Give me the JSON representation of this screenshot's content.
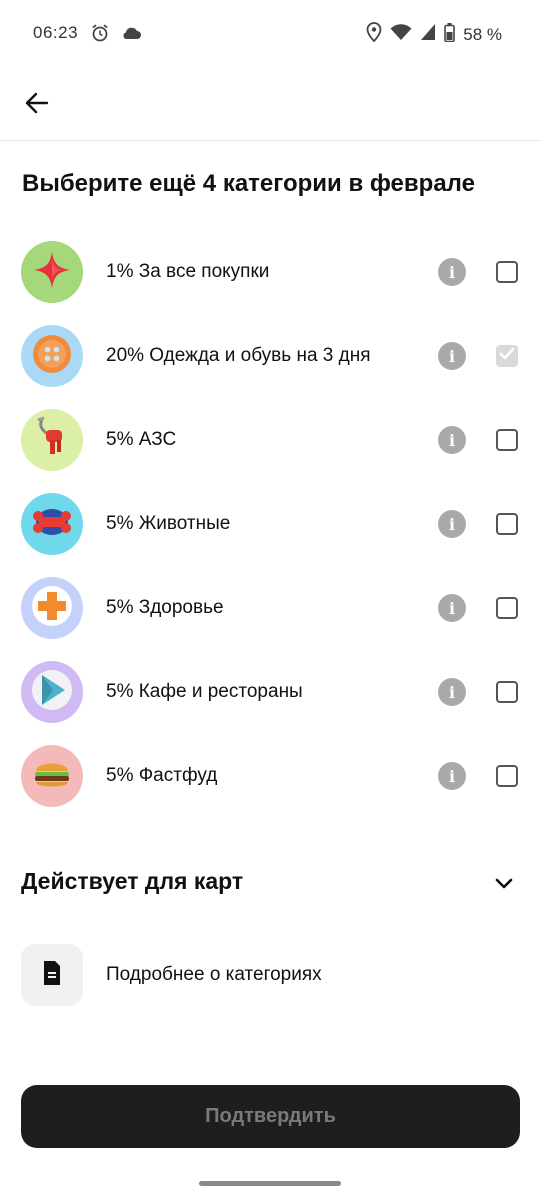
{
  "status_bar": {
    "time": "06:23",
    "battery": "58 %",
    "left_icons": [
      "alarm-icon",
      "cloud-icon"
    ],
    "right_icons": [
      "location-icon",
      "wifi-icon",
      "signal-icon",
      "battery-icon"
    ]
  },
  "header": {
    "back_icon": "arrow-left-icon",
    "title": "Выберите ещё 4 категории в феврале"
  },
  "categories": [
    {
      "label": "1% За все покупки",
      "icon": "star-icon",
      "bg": "#a4d87a",
      "checked": false
    },
    {
      "label": "20% Одежда и обувь на 3 дня",
      "icon": "button-icon",
      "bg": "#a9d9f5",
      "checked": true
    },
    {
      "label": "5% АЗС",
      "icon": "fuel-nozzle-icon",
      "bg": "#dcefa6",
      "checked": false
    },
    {
      "label": "5% Животные",
      "icon": "bone-icon",
      "bg": "#6fd8ea",
      "checked": false
    },
    {
      "label": "5% Здоровье",
      "icon": "medical-cross-icon",
      "bg": "#c3d1fb",
      "checked": false
    },
    {
      "label": "5% Кафе и рестораны",
      "icon": "play-icon",
      "bg": "#cfbaf4",
      "checked": false
    },
    {
      "label": "5% Фастфуд",
      "icon": "burger-icon",
      "bg": "#f4b9b9",
      "checked": false
    }
  ],
  "cards_section": {
    "title": "Действует для карт",
    "icon": "chevron-down-icon"
  },
  "more_link": {
    "label": "Подробнее о категориях",
    "icon": "document-icon"
  },
  "confirm": {
    "label": "Подтвердить"
  }
}
